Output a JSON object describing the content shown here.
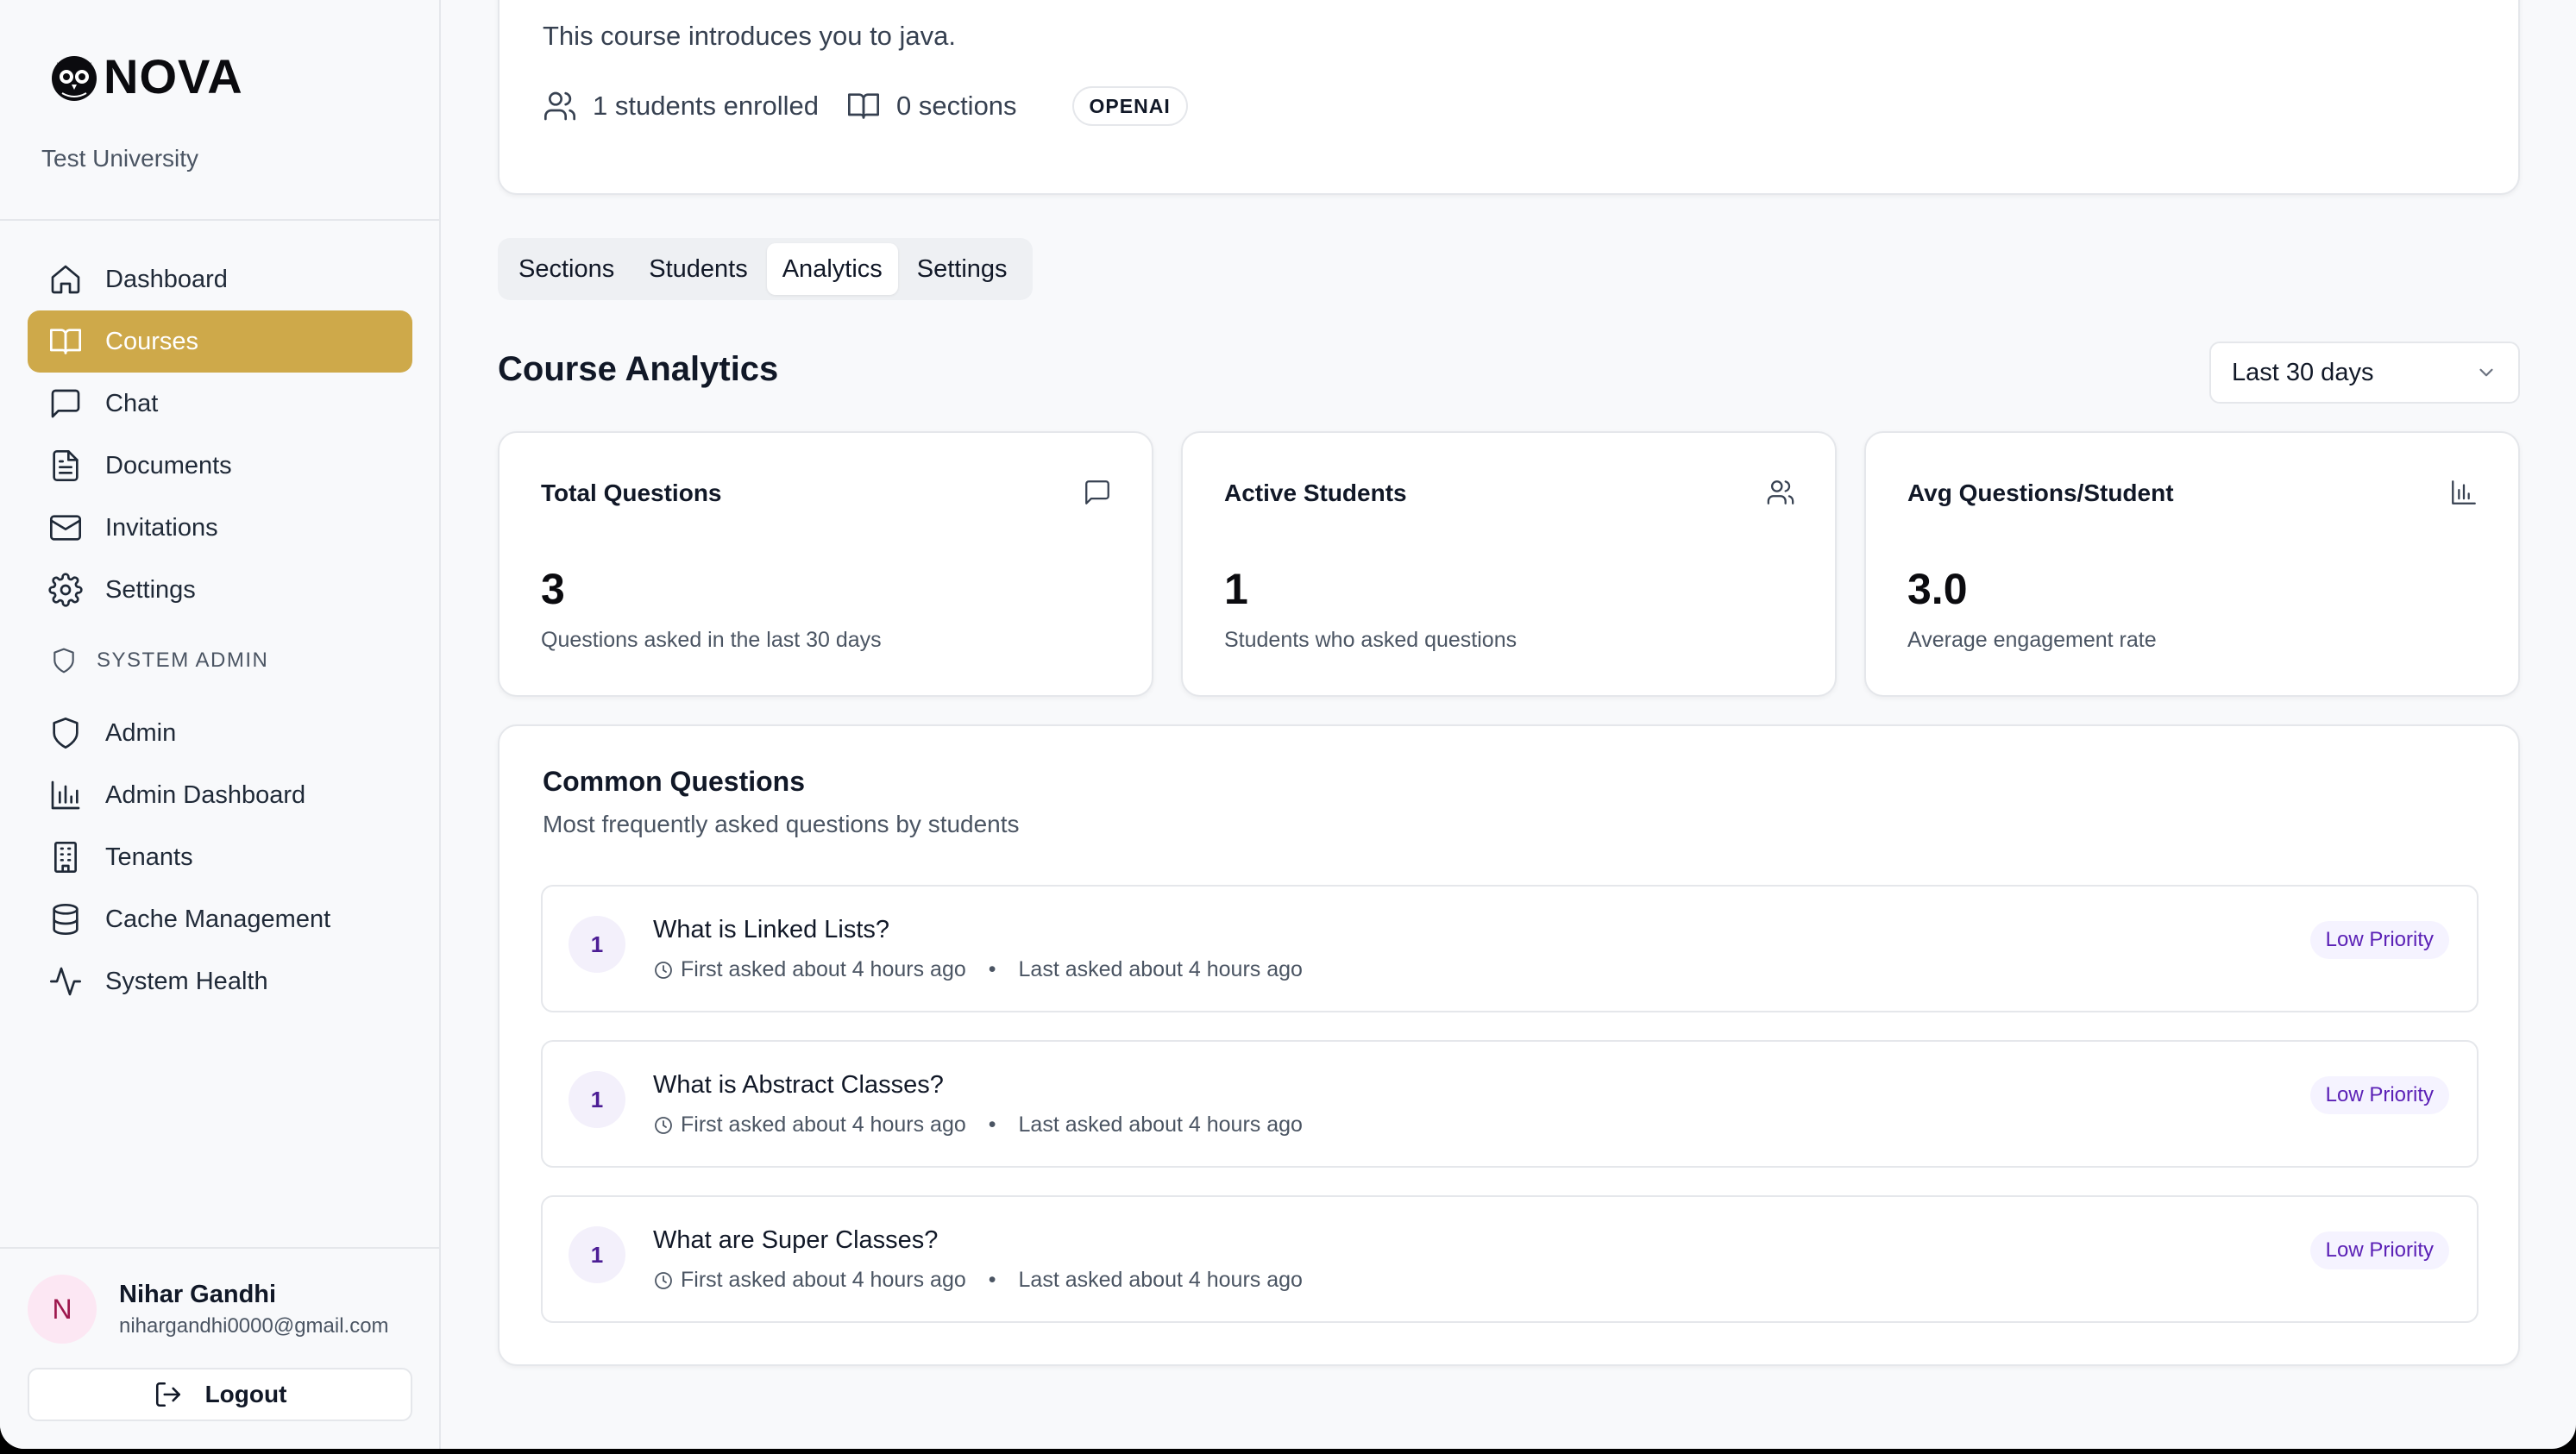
{
  "brand": {
    "name": "NOVA",
    "tenant": "Test University"
  },
  "sidebar": {
    "items": [
      {
        "label": "Dashboard",
        "icon": "home-icon"
      },
      {
        "label": "Courses",
        "icon": "book-icon",
        "active": true
      },
      {
        "label": "Chat",
        "icon": "chat-icon"
      },
      {
        "label": "Documents",
        "icon": "document-icon"
      },
      {
        "label": "Invitations",
        "icon": "mail-icon"
      },
      {
        "label": "Settings",
        "icon": "gear-icon"
      }
    ],
    "admin_section_label": "SYSTEM ADMIN",
    "admin_items": [
      {
        "label": "Admin",
        "icon": "shield-icon"
      },
      {
        "label": "Admin Dashboard",
        "icon": "bar-chart-icon"
      },
      {
        "label": "Tenants",
        "icon": "building-icon"
      },
      {
        "label": "Cache Management",
        "icon": "database-icon"
      },
      {
        "label": "System Health",
        "icon": "activity-icon"
      }
    ],
    "user": {
      "initial": "N",
      "name": "Nihar Gandhi",
      "email": "nihargandhi0000@gmail.com"
    },
    "logout_label": "Logout"
  },
  "course": {
    "description": "This course introduces you to java.",
    "students_enrolled": "1 students enrolled",
    "sections": "0 sections",
    "provider": "OPENAI"
  },
  "tabs": [
    "Sections",
    "Students",
    "Analytics",
    "Settings"
  ],
  "active_tab": "Analytics",
  "analytics": {
    "title": "Course Analytics",
    "range": "Last 30 days",
    "stats": [
      {
        "title": "Total Questions",
        "value": "3",
        "sub": "Questions asked in the last 30 days",
        "icon": "message-square-icon"
      },
      {
        "title": "Active Students",
        "value": "1",
        "sub": "Students who asked questions",
        "icon": "users-icon"
      },
      {
        "title": "Avg Questions/Student",
        "value": "3.0",
        "sub": "Average engagement rate",
        "icon": "bar-chart-icon"
      }
    ]
  },
  "common_questions": {
    "title": "Common Questions",
    "subtitle": "Most frequently asked questions by students",
    "items": [
      {
        "count": "1",
        "text": "What is Linked Lists?",
        "first": "First asked about 4 hours ago",
        "last": "Last asked about 4 hours ago",
        "priority": "Low Priority"
      },
      {
        "count": "1",
        "text": "What is Abstract Classes?",
        "first": "First asked about 4 hours ago",
        "last": "Last asked about 4 hours ago",
        "priority": "Low Priority"
      },
      {
        "count": "1",
        "text": "What are Super Classes?",
        "first": "First asked about 4 hours ago",
        "last": "Last asked about 4 hours ago",
        "priority": "Low Priority"
      }
    ],
    "separator": "•"
  },
  "colors": {
    "accent": "#cea94a",
    "badge_bg": "#f5f3ff",
    "badge_text": "#5b21b6"
  }
}
